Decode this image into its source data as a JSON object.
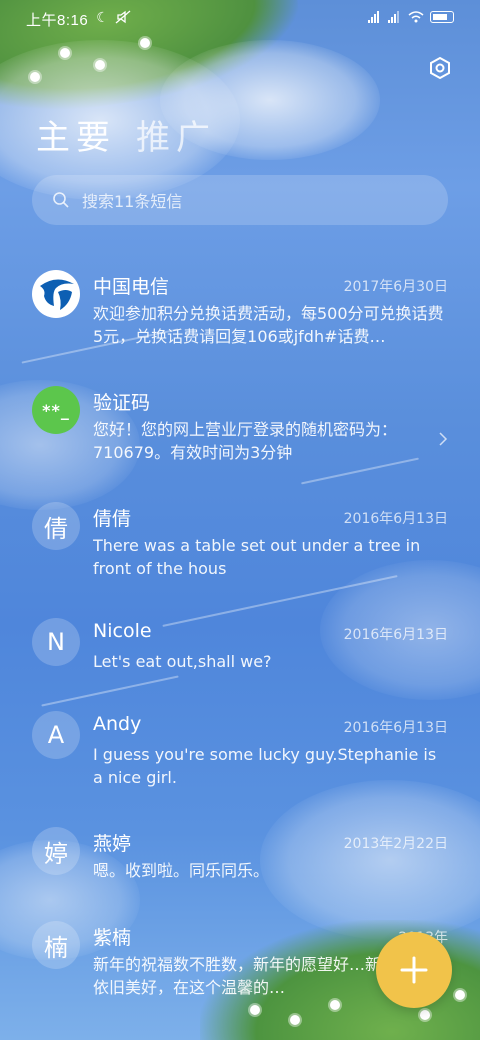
{
  "status_bar": {
    "time": "上午8:16",
    "moon_icon": "moon-icon",
    "mute_icon": "mute-icon"
  },
  "header": {
    "settings_icon": "settings-hexagon-icon",
    "tabs": [
      {
        "label": "主要",
        "active": true
      },
      {
        "label": "推广",
        "active": false
      }
    ]
  },
  "search": {
    "placeholder": "搜索11条短信",
    "icon": "search-icon"
  },
  "messages": [
    {
      "name": "中国电信",
      "date": "2017年6月30日",
      "preview": "欢迎参加积分兑换话费活动，每500分可兑换话费5元，兑换话费请回复106或jfdh#话费…",
      "avatar_type": "telecom-logo",
      "avatar_text": ""
    },
    {
      "name": "验证码",
      "date": "",
      "preview": "您好！您的网上营业厅登录的随机密码为：710679。有效时间为3分钟",
      "avatar_type": "code",
      "avatar_text": "**_"
    },
    {
      "name": "倩倩",
      "date": "2016年6月13日",
      "preview": "There was a table set out under a tree in front of the hous",
      "avatar_type": "letter",
      "avatar_text": "倩"
    },
    {
      "name": "Nicole",
      "date": "2016年6月13日",
      "preview": "Let's eat out,shall we?",
      "avatar_type": "letter",
      "avatar_text": "N"
    },
    {
      "name": "Andy",
      "date": "2016年6月13日",
      "preview": "I guess you're some lucky guy.Stephanie is a nice girl.",
      "avatar_type": "letter",
      "avatar_text": "A"
    },
    {
      "name": "燕婷",
      "date": "2013年2月22日",
      "preview": "嗯。收到啦。同乐同乐。",
      "avatar_type": "letter",
      "avatar_text": "婷"
    },
    {
      "name": "紫楠",
      "date": "2013年",
      "preview": "新年的祝福数不胜数，新年的愿望好…新年的问候依旧美好，在这个温馨的…",
      "avatar_type": "letter",
      "avatar_text": "楠"
    }
  ],
  "fab": {
    "icon": "plus-icon",
    "label": "+"
  },
  "colors": {
    "accent_fab": "#f1c34a",
    "code_avatar": "#5cc64c",
    "telecom_blue": "#0d5fb3"
  }
}
